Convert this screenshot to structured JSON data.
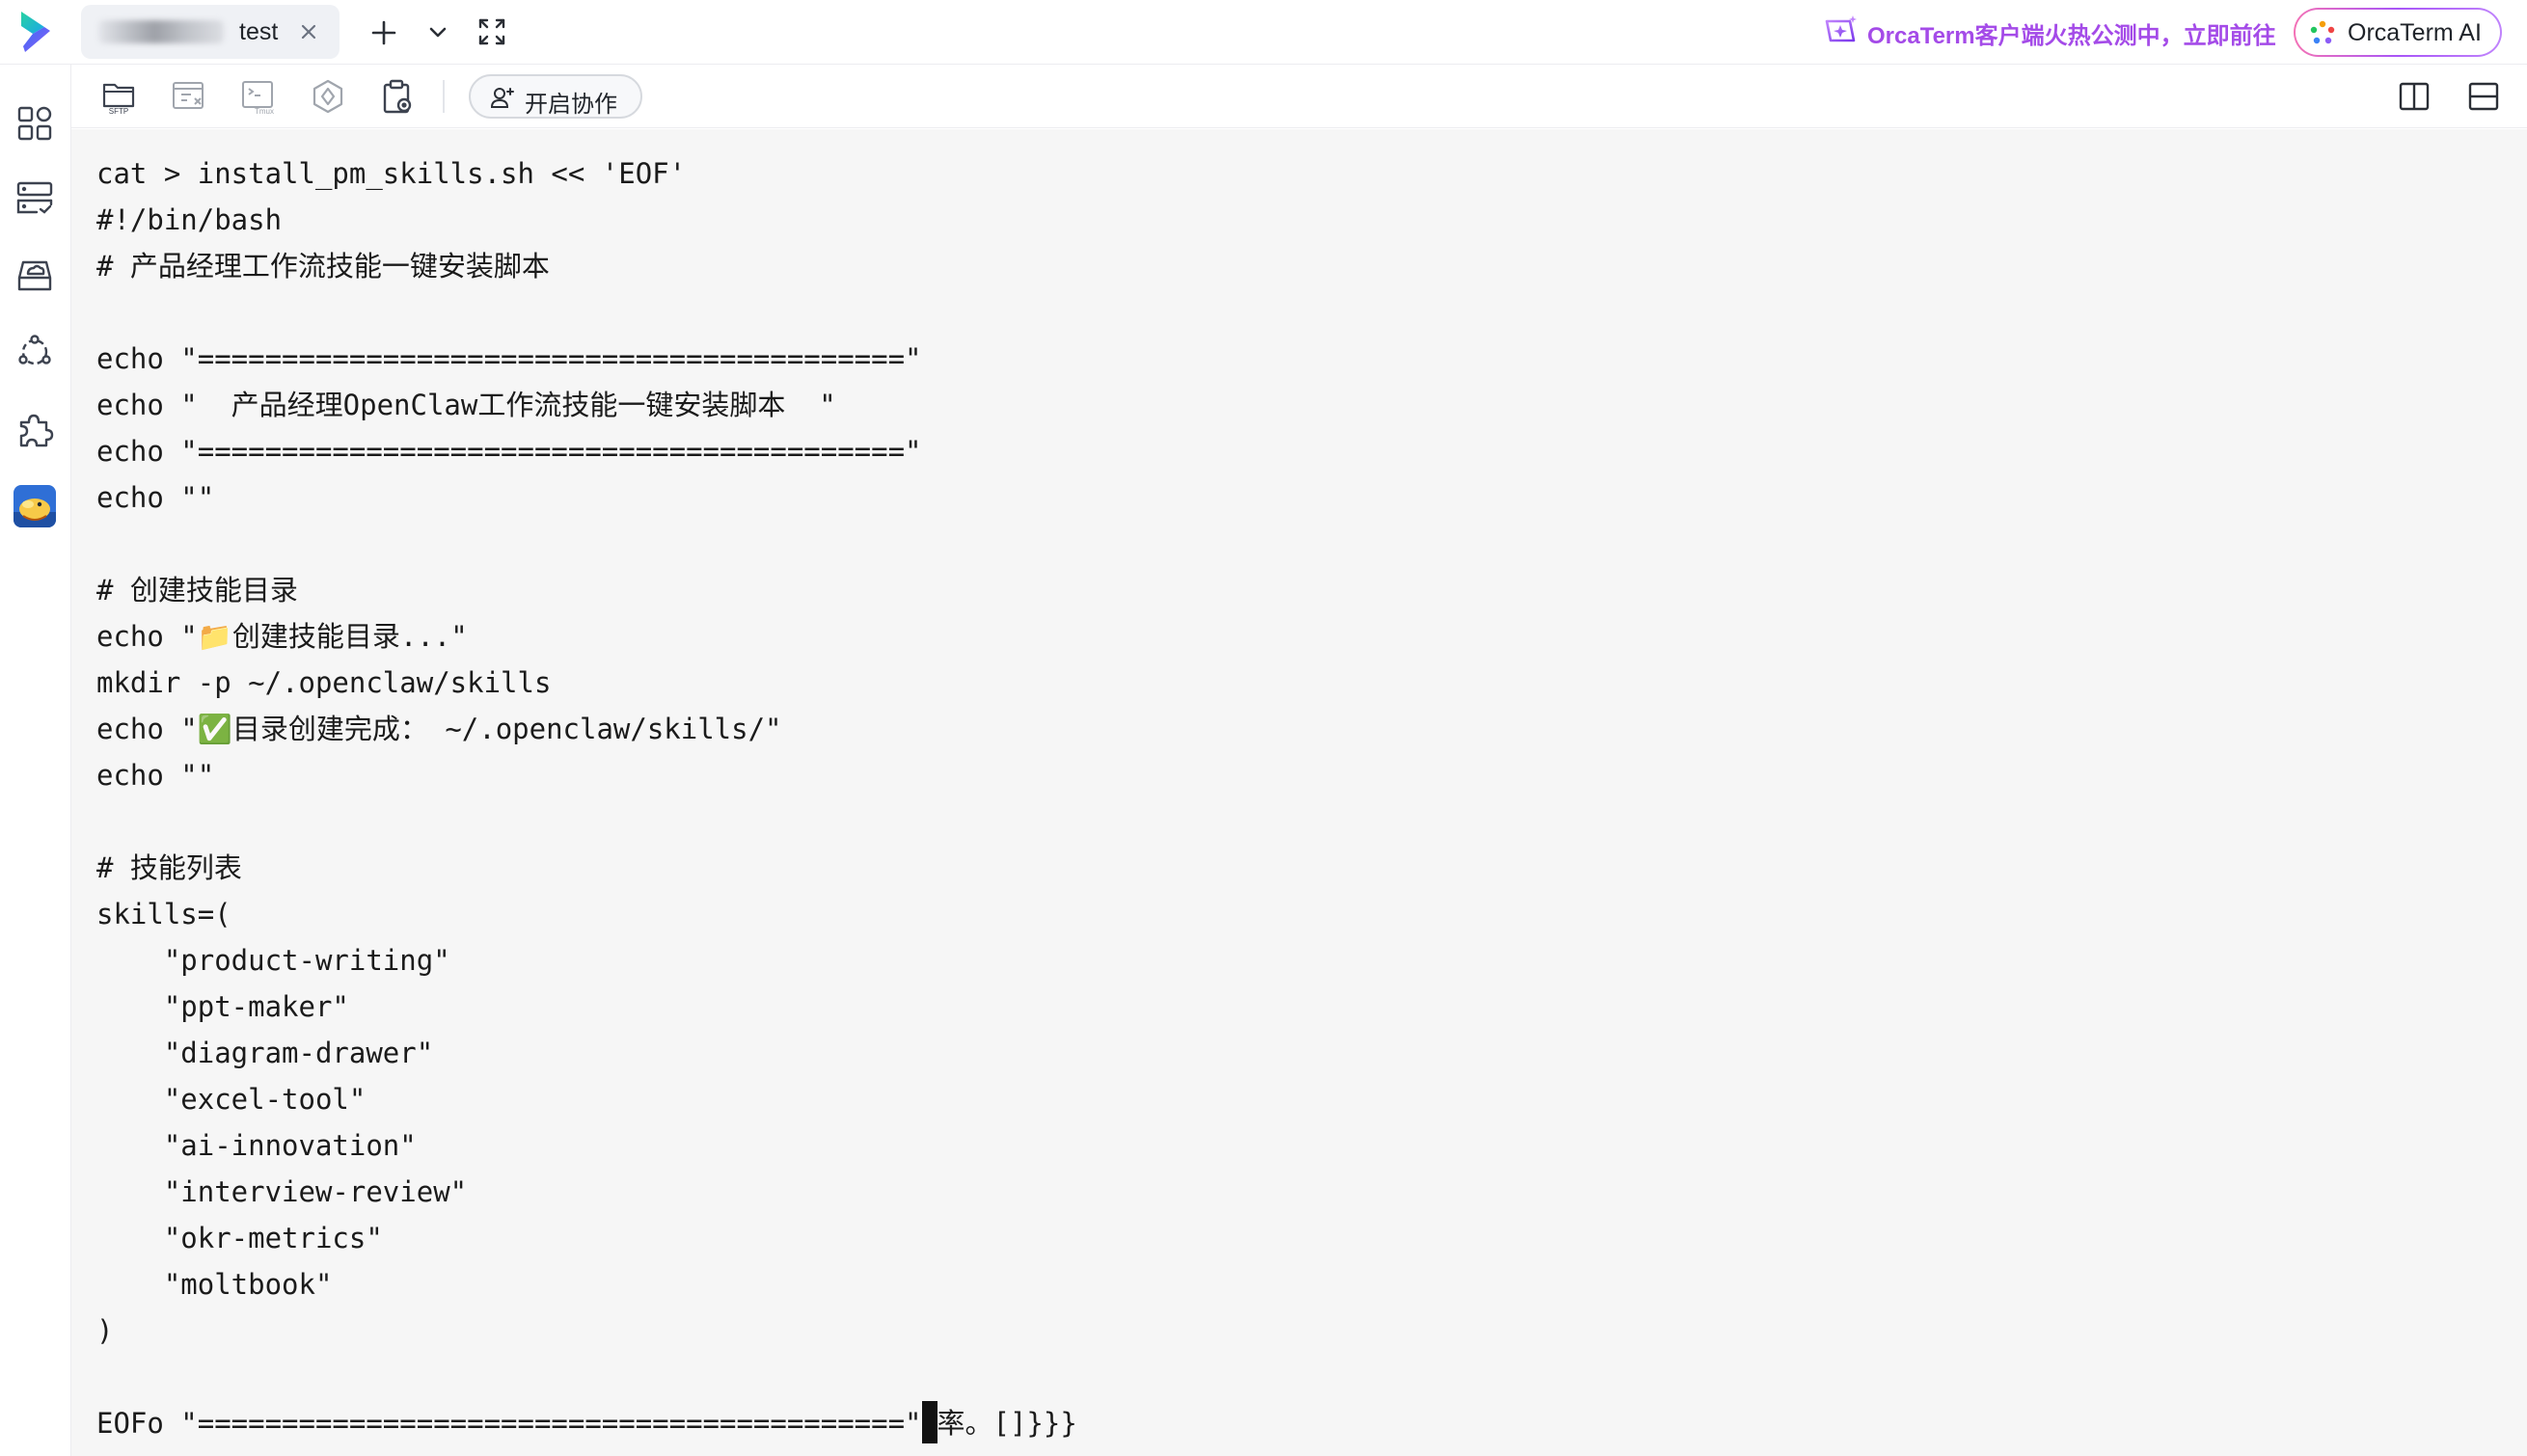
{
  "tab": {
    "host_label": "test"
  },
  "promo": {
    "text": "OrcaTerm客户端火热公测中，立即前往"
  },
  "orca_ai": {
    "label": "OrcaTerm AI"
  },
  "toolbar": {
    "collab_label": "开启协作",
    "sftp_text": "SFTP",
    "tmux_text": "Tmux"
  },
  "terminal": {
    "lines": [
      "cat > install_pm_skills.sh << 'EOF'",
      "#!/bin/bash",
      "# 产品经理工作流技能一键安装脚本",
      "",
      "echo \"==========================================\"",
      "echo \"  产品经理OpenClaw工作流技能一键安装脚本  \"",
      "echo \"==========================================\"",
      "echo \"\"",
      "",
      "# 创建技能目录",
      "echo \"📁创建技能目录...\"",
      "mkdir -p ~/.openclaw/skills",
      "echo \"✅目录创建完成： ~/.openclaw/skills/\"",
      "echo \"\"",
      "",
      "# 技能列表",
      "skills=(",
      "    \"product-writing\"",
      "    \"ppt-maker\"",
      "    \"diagram-drawer\"",
      "    \"excel-tool\"",
      "    \"ai-innovation\"",
      "    \"interview-review\"",
      "    \"okr-metrics\"",
      "    \"moltbook\"",
      ")",
      ""
    ],
    "prompt_line_before_cursor": "EOFo \"==========================================\"",
    "prompt_line_after_cursor": "率。[]}}}"
  },
  "colors": {
    "accent_purple": "#a44be8",
    "terminal_bg": "#f6f6f6",
    "brand_green": "#23c18f",
    "brand_blue": "#3b6cf6"
  },
  "icons": [
    "app-logo-icon",
    "close-icon",
    "plus-icon",
    "chevron-down-icon",
    "fullscreen-icon",
    "sparkle-icon",
    "orca-ai-icon",
    "dashboard-icon",
    "hosts-icon",
    "cloud-storage-icon",
    "network-icon",
    "plugin-icon",
    "avatar",
    "sftp-folder-icon",
    "layout-icon",
    "tmux-icon",
    "ai-hexagon-icon",
    "clipboard-icon",
    "user-plus-icon",
    "split-vertical-icon",
    "split-horizontal-icon"
  ]
}
